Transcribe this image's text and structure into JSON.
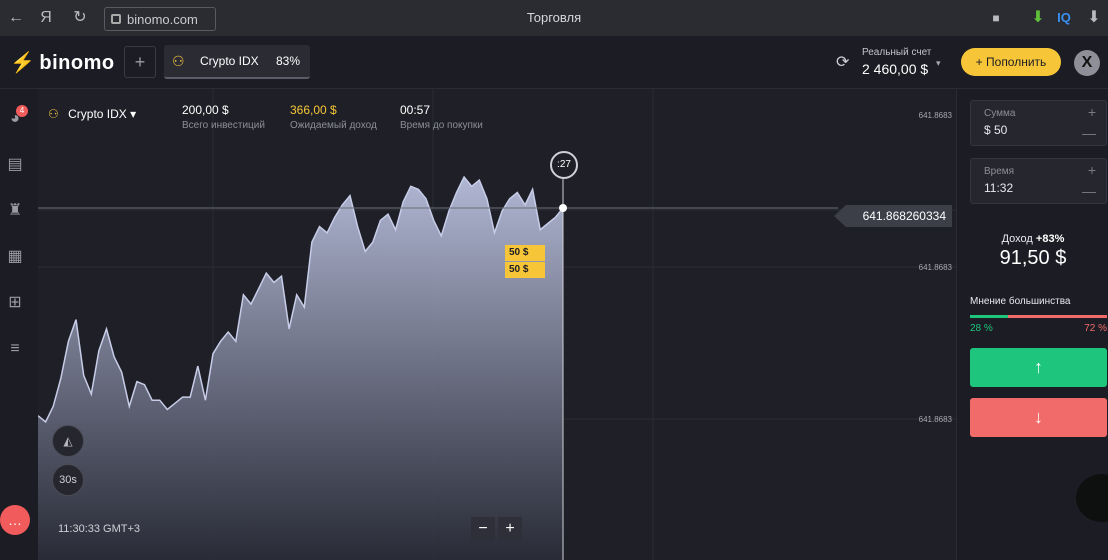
{
  "browser": {
    "back": "←",
    "yandex": "Я",
    "reload": "↻",
    "url": "binomo.com",
    "tab_title": "Торговля",
    "ext_iq": "IQ",
    "bookmark": "■",
    "download": "⬇"
  },
  "header": {
    "logo": "binomo",
    "add_tab": "+",
    "asset_tab": {
      "name": "Crypto IDX",
      "percent": "83%"
    },
    "account": {
      "label": "Реальный счет",
      "balance": "2 460,00 $",
      "dropdown": "▾",
      "sync": "⟳"
    },
    "deposit_label": "+ Пополнить",
    "avatar": "X"
  },
  "sidebar": {
    "badge": "4",
    "icons": [
      "trades-icon",
      "chart-icon",
      "trophy-icon",
      "calendar-icon",
      "gift-icon",
      "settings-icon"
    ],
    "chat": "💬"
  },
  "chart_info": {
    "asset": "Crypto IDX",
    "asset_dropdown": "▾",
    "investments_value": "200,00 $",
    "investments_label": "Всего инвестиций",
    "expected_value": "366,00 $",
    "expected_label": "Ожидаемый доход",
    "time_value": "00:57",
    "time_label": "Время до покупки"
  },
  "chart": {
    "current_price": "641.868260334",
    "timer": ":27",
    "tick_labels": [
      "641.8683",
      "641.8683",
      "641.8683"
    ],
    "trade_tags": [
      "50 $",
      "50 $"
    ],
    "chart_type_icon": "area-chart-icon",
    "timeframe": "30s",
    "clock": "11:30:33 GMT+3",
    "zoom_out": "−",
    "zoom_in": "+"
  },
  "chart_data": {
    "type": "area",
    "x": [
      0,
      1,
      2,
      3,
      4,
      5,
      6,
      7,
      8,
      9,
      10,
      11,
      12,
      13,
      14,
      15,
      16,
      17,
      18,
      19,
      20,
      21,
      22,
      23,
      24,
      25,
      26,
      27,
      28,
      29,
      30,
      31,
      32,
      33,
      34,
      35,
      36,
      37,
      38,
      39,
      40,
      41,
      42,
      43,
      44,
      45,
      46,
      47,
      48,
      49,
      50,
      51,
      52,
      53,
      54,
      55,
      56,
      57,
      58,
      59,
      60,
      61,
      62,
      63,
      64,
      65,
      66,
      67,
      68,
      69
    ],
    "y": [
      0.23,
      0.21,
      0.26,
      0.35,
      0.47,
      0.54,
      0.36,
      0.3,
      0.44,
      0.51,
      0.42,
      0.37,
      0.26,
      0.34,
      0.33,
      0.28,
      0.28,
      0.25,
      0.27,
      0.29,
      0.29,
      0.39,
      0.28,
      0.43,
      0.47,
      0.5,
      0.47,
      0.62,
      0.59,
      0.64,
      0.69,
      0.66,
      0.68,
      0.51,
      0.62,
      0.58,
      0.79,
      0.84,
      0.82,
      0.87,
      0.91,
      0.94,
      0.84,
      0.76,
      0.79,
      0.86,
      0.88,
      0.83,
      0.92,
      0.97,
      0.96,
      0.93,
      0.86,
      0.81,
      0.89,
      0.95,
      1.0,
      0.97,
      0.99,
      0.93,
      0.82,
      0.89,
      0.93,
      0.95,
      0.91,
      0.96,
      0.83,
      0.85,
      0.87,
      0.9
    ],
    "color": "#c7cde8"
  },
  "panel": {
    "amount_label": "Сумма",
    "amount_value": "$ 50",
    "time_label": "Время",
    "time_value": "11:32",
    "plus": "+",
    "minus": "—",
    "income_label": "Доход",
    "income_percent": "+83%",
    "income_value": "91,50 $",
    "opinion_label": "Мнение большинства",
    "opinion_up": "28 %",
    "opinion_down": "72 %",
    "opinion_up_fraction": 0.28,
    "up_icon": "↑",
    "down_icon": "↓"
  }
}
